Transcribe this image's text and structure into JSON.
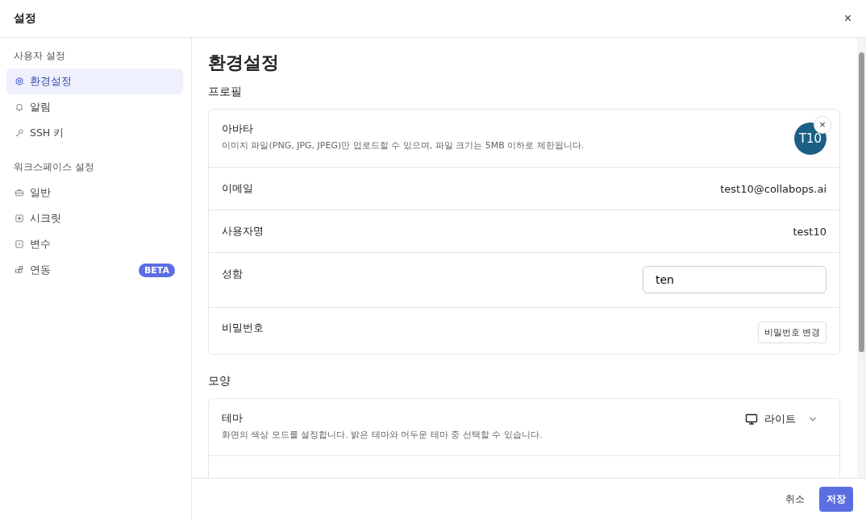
{
  "window": {
    "title": "설정",
    "close": "×"
  },
  "sidebar": {
    "groups": [
      {
        "heading": "사용자 설정",
        "items": [
          {
            "label": "환경설정",
            "selected": true
          },
          {
            "label": "알림",
            "selected": false
          },
          {
            "label": "SSH 키",
            "selected": false
          }
        ]
      },
      {
        "heading": "워크스페이스 설정",
        "items": [
          {
            "label": "일반",
            "selected": false
          },
          {
            "label": "시크릿",
            "selected": false
          },
          {
            "label": "변수",
            "selected": false
          },
          {
            "label": "연동",
            "selected": false,
            "badge": "BETA"
          }
        ]
      }
    ]
  },
  "main": {
    "title": "환경설정",
    "sections": [
      {
        "heading": "프로필",
        "rows": [
          {
            "kind": "avatar",
            "label": "아바타",
            "description": "이미지 파일(PNG, JPG, JPEG)만 업로드할 수 있으며, 파일 크기는 5MB 이하로 제한됩니다.",
            "initials": "T10",
            "remove": "×"
          },
          {
            "kind": "text",
            "label": "이메일",
            "value": "test10@collabops.ai"
          },
          {
            "kind": "text",
            "label": "사용자명",
            "value": "test10"
          },
          {
            "kind": "input",
            "label": "성함",
            "value": "ten"
          },
          {
            "kind": "button",
            "label": "비밀번호",
            "button": "비밀번호 변경"
          }
        ]
      },
      {
        "heading": "모양",
        "rows": [
          {
            "kind": "select",
            "label": "테마",
            "description": "화면의 색상 모드를 설정합니다. 밝은 테마와 어두운 테마 중 선택할 수 있습니다.",
            "value": "라이트"
          },
          {
            "kind": "text"
          }
        ]
      }
    ]
  },
  "footer": {
    "cancel": "취소",
    "save": "저장"
  }
}
